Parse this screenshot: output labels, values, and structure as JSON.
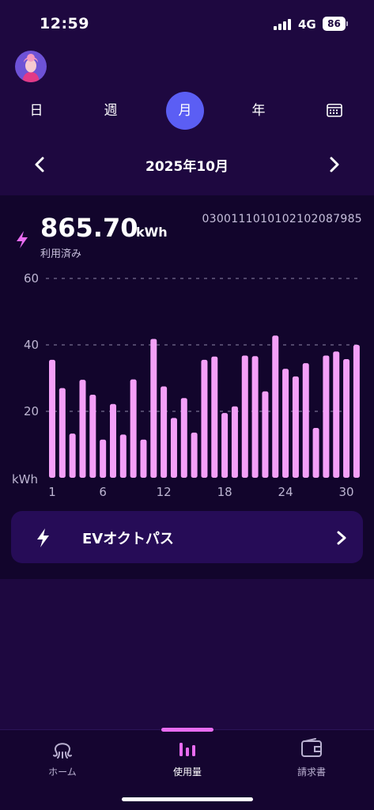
{
  "status_bar": {
    "time": "12:59",
    "network": "4G",
    "battery": "86"
  },
  "period_tabs": [
    {
      "label": "日",
      "active": false
    },
    {
      "label": "週",
      "active": false
    },
    {
      "label": "月",
      "active": true
    },
    {
      "label": "年",
      "active": false
    }
  ],
  "month_nav": {
    "label": "2025年10月"
  },
  "usage": {
    "meter_id": "0300111010102102087985",
    "total": "865.70",
    "unit": "kWh",
    "caption": "利用済み"
  },
  "chart_data": {
    "type": "bar",
    "x": [
      1,
      2,
      3,
      4,
      5,
      6,
      7,
      8,
      9,
      10,
      11,
      12,
      13,
      14,
      15,
      16,
      17,
      18,
      19,
      20,
      21,
      22,
      23,
      24,
      25,
      26,
      27,
      28,
      29,
      30,
      31
    ],
    "values": [
      35.5,
      27,
      13.3,
      29.5,
      25,
      11.5,
      22.2,
      13,
      29.6,
      11.5,
      41.8,
      27.5,
      18,
      24,
      13.6,
      35.5,
      36.5,
      19.5,
      21.5,
      36.8,
      36.6,
      26,
      42.8,
      32.8,
      30.5,
      34.5,
      15,
      36.8,
      38,
      35.7,
      40
    ],
    "x_tick_labels": [
      "1",
      "6",
      "12",
      "18",
      "24",
      "30"
    ],
    "y_tick_labels": [
      "60",
      "40",
      "20",
      "kWh"
    ],
    "ylim": [
      0,
      60
    ],
    "grid": true,
    "bar_color": "#f4a0f8",
    "grid_color": "#8f87a8"
  },
  "ev_card": {
    "label": "EVオクトパス"
  },
  "bottom_nav": [
    {
      "label": "ホーム",
      "icon": "octopus-icon",
      "active": false
    },
    {
      "label": "使用量",
      "icon": "bar-chart-icon",
      "active": true
    },
    {
      "label": "請求書",
      "icon": "wallet-icon",
      "active": false
    }
  ],
  "colors": {
    "background": "#1e0840",
    "card": "#12052c",
    "accent": "#5b5ef4",
    "pink": "#e86cf0"
  }
}
